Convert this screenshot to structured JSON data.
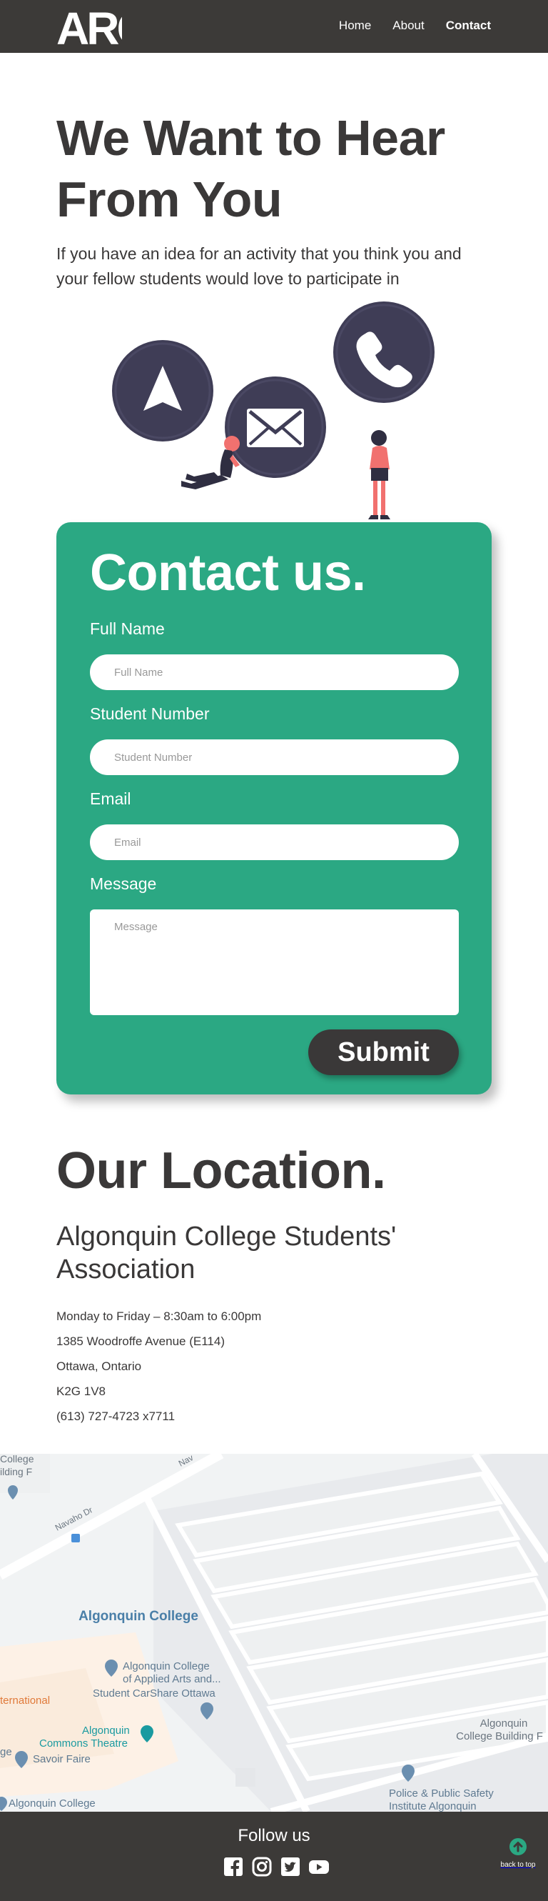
{
  "nav": {
    "logo_text": "ARC",
    "links": [
      {
        "label": "Home",
        "active": false
      },
      {
        "label": "About",
        "active": false
      },
      {
        "label": "Contact",
        "active": true
      }
    ]
  },
  "hero": {
    "title": "We Want to Hear From You",
    "subtitle": "If you have an idea for an activity that you think you and your fellow students would love to participate in",
    "illustration_icons": [
      "navigation-arrow-icon",
      "envelope-icon",
      "phone-icon"
    ]
  },
  "contact_form": {
    "title": "Contact us.",
    "fields": {
      "full_name": {
        "label": "Full Name",
        "placeholder": "Full Name",
        "value": ""
      },
      "student_number": {
        "label": "Student Number",
        "placeholder": "Student Number",
        "value": ""
      },
      "email": {
        "label": "Email",
        "placeholder": "Email",
        "value": ""
      },
      "message": {
        "label": "Message",
        "placeholder": "Message",
        "value": ""
      }
    },
    "submit_label": "Submit"
  },
  "location": {
    "title": "Our Location.",
    "organization": "Algonquin College Students' Association",
    "lines": [
      "Monday to Friday – 8:30am to 6:00pm",
      "1385 Woodroffe Avenue (E114)",
      "Ottawa, Ontario",
      "K2G 1V8",
      "(613) 727-4723 x7711"
    ]
  },
  "map": {
    "labels": {
      "college_top": "College",
      "building_top": "ilding F",
      "street_navaho": "Navaho Dr",
      "street_nav_top": "Nav",
      "algonquin_college": "Algonquin College",
      "applied_arts_1": "Algonquin College",
      "applied_arts_2": "of Applied Arts and...",
      "carshare": "Student CarShare Ottawa",
      "international": "ternational",
      "commons_1": "Algonquin",
      "commons_2": "Commons Theatre",
      "savoir_faire": "Savoir Faire",
      "college_bottom": "Algonquin College",
      "building_right_1": "Algonquin",
      "building_right_2": "College Building F",
      "police_1": "Police & Public Safety",
      "police_2": "Institute Algonquin",
      "left_ge": "ge"
    }
  },
  "footer": {
    "follow_label": "Follow us",
    "socials": [
      "facebook-icon",
      "instagram-icon",
      "twitter-icon",
      "youtube-icon"
    ],
    "back_to_top_label": "back to top"
  },
  "colors": {
    "dark": "#3c3a38",
    "text": "#3a3838",
    "accent_green": "#2ba883",
    "illustration_navy": "#3f3d56",
    "illustration_coral": "#f1716f"
  }
}
